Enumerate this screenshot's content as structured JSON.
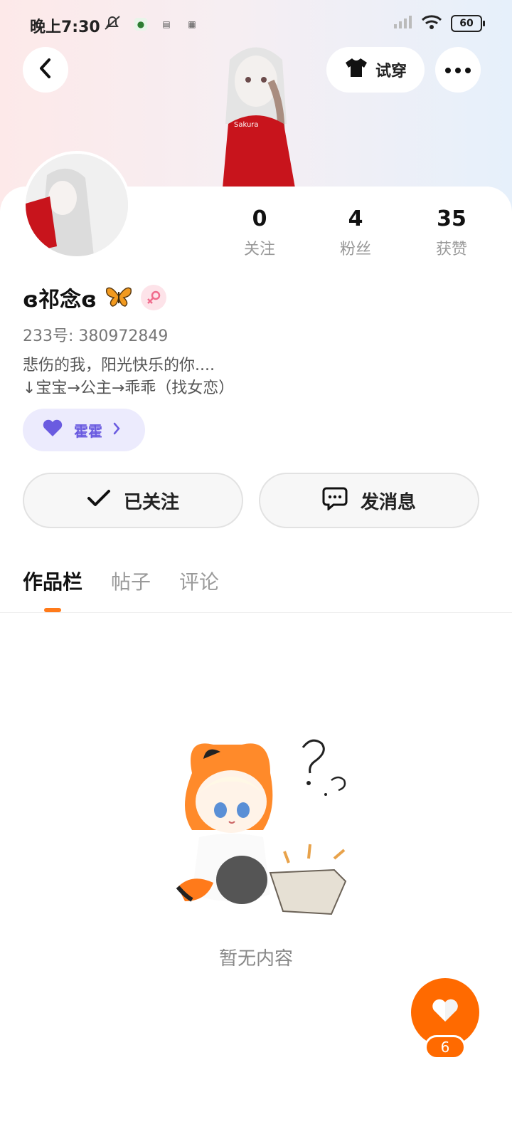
{
  "status_bar": {
    "time": "晚上7:30",
    "battery": "60"
  },
  "header": {
    "try_on_label": "试穿"
  },
  "profile": {
    "stats": [
      {
        "value": "0",
        "label": "关注"
      },
      {
        "value": "4",
        "label": "粉丝"
      },
      {
        "value": "35",
        "label": "获赞"
      }
    ],
    "nickname": "ɞ祁念ɞ",
    "uid": "233号: 380972849",
    "bio_line1": "悲伤的我，阳光快乐的你....",
    "bio_line2": "↓宝宝→公主→乖乖（找女恋）",
    "tag_label": "霍霍"
  },
  "actions": {
    "follow_label": "已关注",
    "message_label": "发消息"
  },
  "tabs": [
    "作品栏",
    "帖子",
    "评论"
  ],
  "empty": {
    "text": "暂无内容"
  },
  "fab": {
    "count": "6"
  },
  "colors": {
    "accent": "#ff6a00",
    "tag_bg": "#ecebfd",
    "tag_text": "#6a5be0"
  }
}
